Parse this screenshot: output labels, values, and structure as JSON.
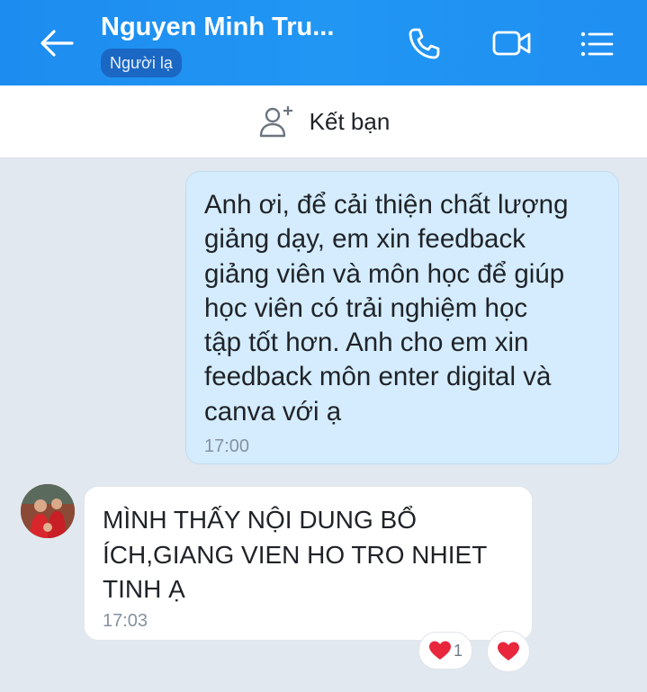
{
  "header": {
    "contact_name": "Nguyen Minh Tru...",
    "status_badge": "Người lạ",
    "icons": [
      "back-arrow-icon",
      "phone-icon",
      "video-call-icon",
      "menu-list-icon"
    ],
    "bg_color": "#1f8ff2"
  },
  "friend_bar": {
    "label": "Kết bạn",
    "icon": "add-friend-icon"
  },
  "messages": [
    {
      "direction": "outgoing",
      "text": "Anh ơi, để cải thiện chất lượng\ngiảng dạy, em xin feedback\ngiảng viên và môn học để giúp\nhọc viên có trải nghiệm học\ntập tốt hơn. Anh cho em xin\nfeedback môn enter digital và\ncanva với ạ",
      "time": "17:00",
      "bubble_color": "#d4ecfd"
    },
    {
      "direction": "incoming",
      "text": "MÌNH THẤY NỘI DUNG BỔ\nÍCH,GIANG VIEN HO TRO NHIET\nTINH Ạ",
      "time": "17:03",
      "bubble_color": "#ffffff",
      "reaction": {
        "icon": "heart-icon",
        "count": "1"
      },
      "quick_react_icon": "heart-icon"
    }
  ],
  "colors": {
    "chat_bg": "#e2e8ef",
    "heart": "#e8273d"
  }
}
